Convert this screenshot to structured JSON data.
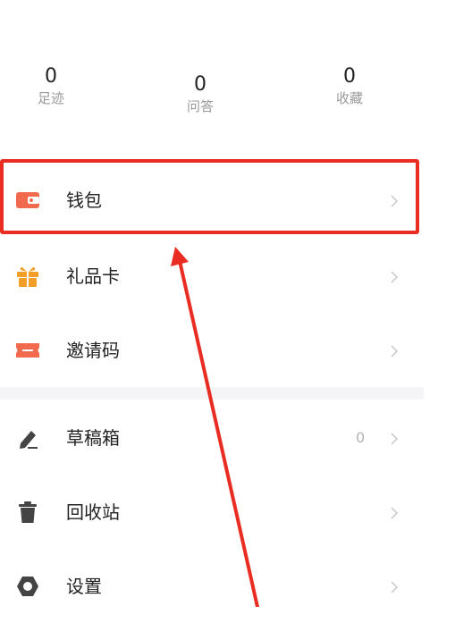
{
  "stats": [
    {
      "value": "0",
      "label": "足迹"
    },
    {
      "value": "0",
      "label": "问答"
    },
    {
      "value": "0",
      "label": "收藏"
    }
  ],
  "menu": {
    "items": [
      {
        "label": "钱包",
        "icon": "wallet-icon",
        "color": "#f16a4e"
      },
      {
        "label": "礼品卡",
        "icon": "gift-icon",
        "color": "#f29f2a"
      },
      {
        "label": "邀请码",
        "icon": "ticket-icon",
        "color": "#f16a4e"
      },
      {
        "label": "草稿箱",
        "icon": "pen-icon",
        "color": "#444444",
        "count": "0"
      },
      {
        "label": "回收站",
        "icon": "trash-icon",
        "color": "#444444"
      },
      {
        "label": "设置",
        "icon": "gear-icon",
        "color": "#444444"
      }
    ]
  },
  "annotation": {
    "highlight_color": "#ea2d22",
    "highlighted_item": "钱包"
  }
}
